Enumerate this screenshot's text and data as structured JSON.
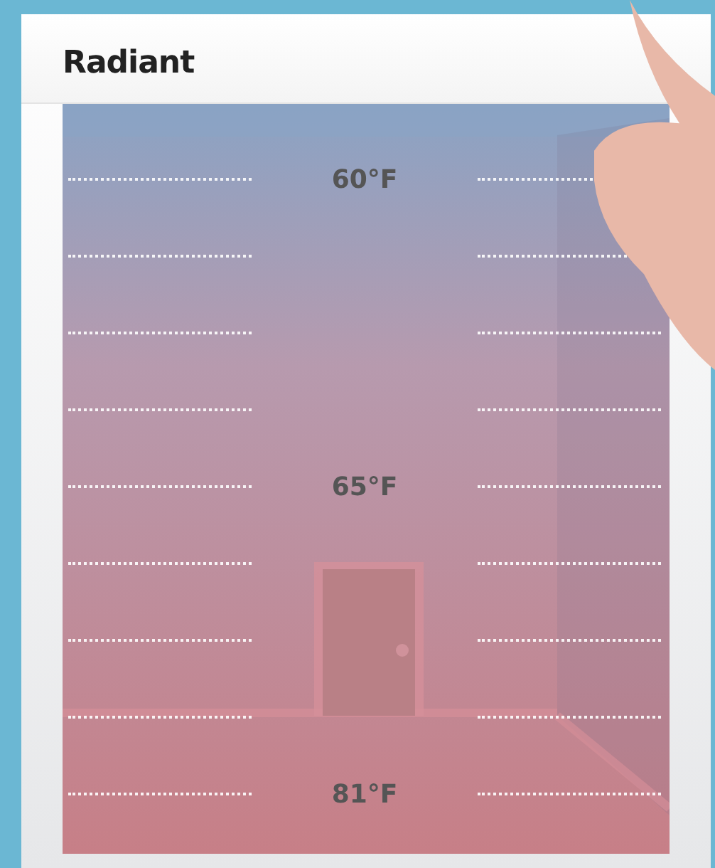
{
  "title": "Radiant",
  "rows": [
    {
      "label": "60°F"
    },
    {},
    {},
    {},
    {
      "label": "65°F"
    },
    {},
    {},
    {},
    {
      "label": "81°F"
    }
  ]
}
